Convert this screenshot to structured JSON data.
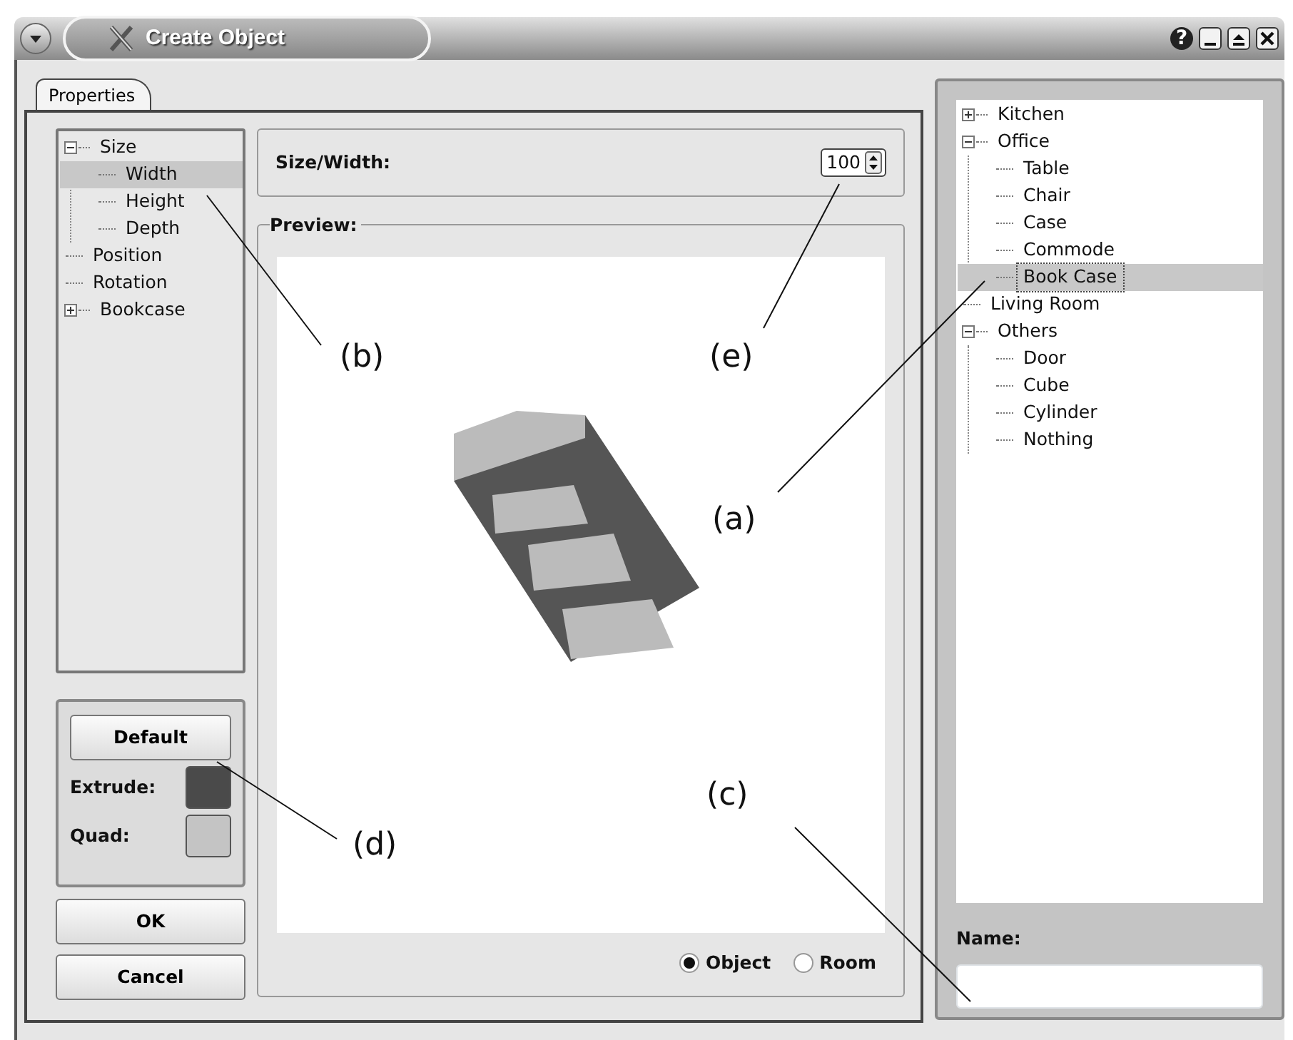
{
  "window": {
    "title": "Create Object",
    "help_button": "?"
  },
  "tabs": [
    {
      "label": "Properties",
      "selected": true
    }
  ],
  "property_tree": [
    {
      "label": "Size",
      "expanded": true,
      "selected": false,
      "children": [
        {
          "label": "Width",
          "selected": true
        },
        {
          "label": "Height",
          "selected": false
        },
        {
          "label": "Depth",
          "selected": false
        }
      ]
    },
    {
      "label": "Position",
      "selected": false
    },
    {
      "label": "Rotation",
      "selected": false
    },
    {
      "label": "Bookcase",
      "expanded": false,
      "selected": false
    }
  ],
  "size_field": {
    "label": "Size/Width:",
    "value": "100"
  },
  "preview": {
    "label": "Preview:",
    "modes": [
      {
        "label": "Object",
        "selected": true
      },
      {
        "label": "Room",
        "selected": false
      }
    ]
  },
  "color_panel": {
    "default_button": "Default",
    "swatches": [
      {
        "label": "Extrude:",
        "color": "#4a4a4a"
      },
      {
        "label": "Quad:",
        "color": "#c4c4c4"
      }
    ]
  },
  "dialog_buttons": [
    "OK",
    "Cancel"
  ],
  "object_tree": [
    {
      "label": "Kitchen",
      "expanded": false,
      "selected": false
    },
    {
      "label": "Office",
      "expanded": true,
      "selected": false,
      "children": [
        {
          "label": "Table",
          "selected": false
        },
        {
          "label": "Chair",
          "selected": false
        },
        {
          "label": "Case",
          "selected": false
        },
        {
          "label": "Commode",
          "selected": false
        },
        {
          "label": "Book Case",
          "selected": true
        }
      ]
    },
    {
      "label": "Living Room",
      "selected": false
    },
    {
      "label": "Others",
      "expanded": true,
      "selected": false,
      "children": [
        {
          "label": "Door",
          "selected": false
        },
        {
          "label": "Cube",
          "selected": false
        },
        {
          "label": "Cylinder",
          "selected": false
        },
        {
          "label": "Nothing",
          "selected": false
        }
      ]
    }
  ],
  "name_field": {
    "label": "Name:"
  },
  "annotations": [
    "(b)",
    "(e)",
    "(a)",
    "(c)",
    "(d)"
  ]
}
